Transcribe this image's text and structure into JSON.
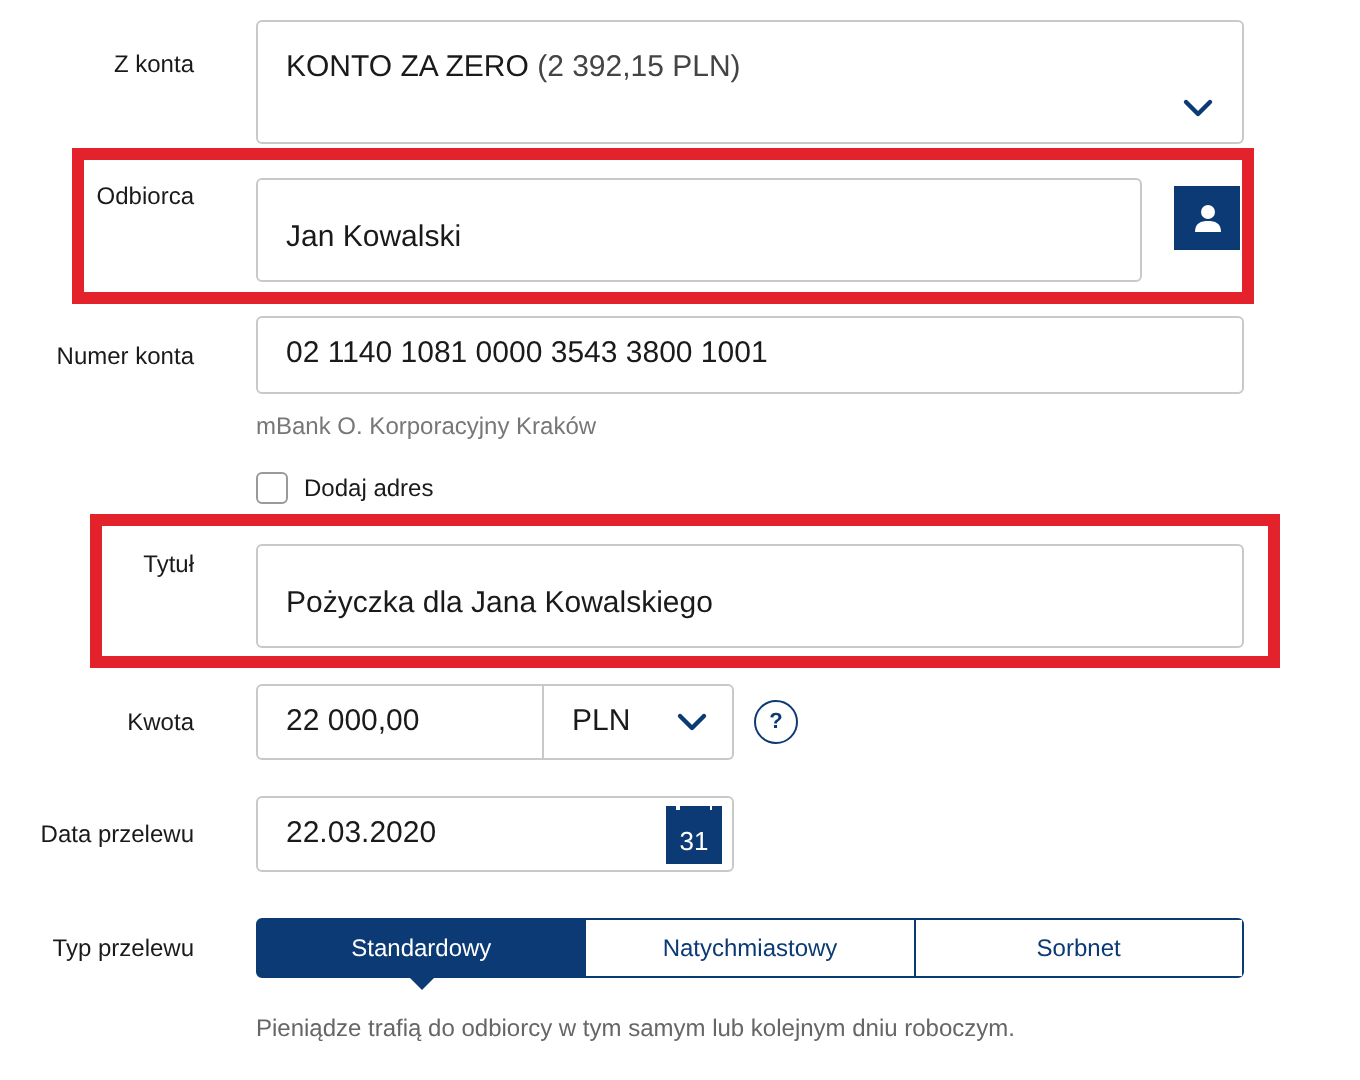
{
  "fields": [
    {
      "kind": "select",
      "label": "Z konta",
      "value": "KONTO ZA ZERO",
      "detail": "(2 392,15 PLN)",
      "highlighted": false
    },
    {
      "kind": "recipient",
      "label": "Odbiorca",
      "value": "Jan Kowalski",
      "highlighted": true
    },
    {
      "kind": "text",
      "label": "Numer konta",
      "value": "02 1140 1081 0000 3543 3800 1001",
      "hint": "mBank O. Korporacyjny Kraków",
      "highlighted": false
    },
    {
      "kind": "checkbox",
      "label": "Dodaj adres",
      "checked": false
    },
    {
      "kind": "tall_text",
      "label": "Tytuł",
      "value": "Pożyczka dla Jana Kowalskiego",
      "highlighted": true
    },
    {
      "kind": "amount",
      "label": "Kwota",
      "value": "22 000,00",
      "currency": "PLN",
      "help": "?",
      "highlighted": false
    },
    {
      "kind": "date",
      "label": "Data przelewu",
      "value": "22.03.2020",
      "day": "31",
      "highlighted": false
    },
    {
      "kind": "segmented",
      "label": "Typ przelewu",
      "options": [
        {
          "label": "Standardowy",
          "selected": true
        },
        {
          "label": "Natychmiastowy",
          "selected": false
        },
        {
          "label": "Sorbnet",
          "selected": false
        }
      ],
      "note": "Pieniądze trafią do odbiorcy w tym samym lub kolejnym dniu roboczym."
    }
  ]
}
